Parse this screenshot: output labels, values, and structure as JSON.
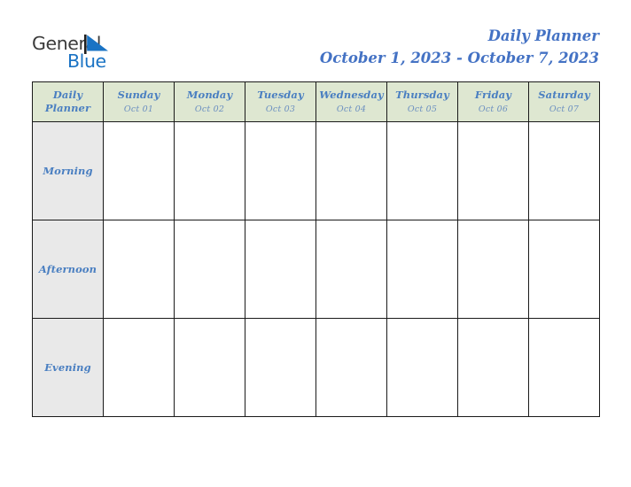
{
  "brand": {
    "name_part1": "General",
    "name_part2": "Blue",
    "mark_icon": "triangle-flag-icon",
    "color_dark": "#3b3b3b",
    "color_blue": "#1a73c4"
  },
  "header": {
    "title": "Daily Planner",
    "date_range": "October 1, 2023 - October 7, 2023",
    "title_color": "#4472c4"
  },
  "table": {
    "corner_label_line1": "Daily",
    "corner_label_line2": "Planner",
    "header_bg": "#dee7d1",
    "slot_label_bg": "#e9e9e9",
    "border_color": "#1a1a1a",
    "text_blue": "#4a7fc1",
    "date_blue": "#6b8fc0",
    "columns": [
      {
        "day": "Sunday",
        "date": "Oct 01"
      },
      {
        "day": "Monday",
        "date": "Oct 02"
      },
      {
        "day": "Tuesday",
        "date": "Oct 03"
      },
      {
        "day": "Wednesday",
        "date": "Oct 04"
      },
      {
        "day": "Thursday",
        "date": "Oct 05"
      },
      {
        "day": "Friday",
        "date": "Oct 06"
      },
      {
        "day": "Saturday",
        "date": "Oct 07"
      }
    ],
    "rows": [
      {
        "label": "Morning",
        "cells": [
          "",
          "",
          "",
          "",
          "",
          "",
          ""
        ]
      },
      {
        "label": "Afternoon",
        "cells": [
          "",
          "",
          "",
          "",
          "",
          "",
          ""
        ]
      },
      {
        "label": "Evening",
        "cells": [
          "",
          "",
          "",
          "",
          "",
          "",
          ""
        ]
      }
    ]
  }
}
